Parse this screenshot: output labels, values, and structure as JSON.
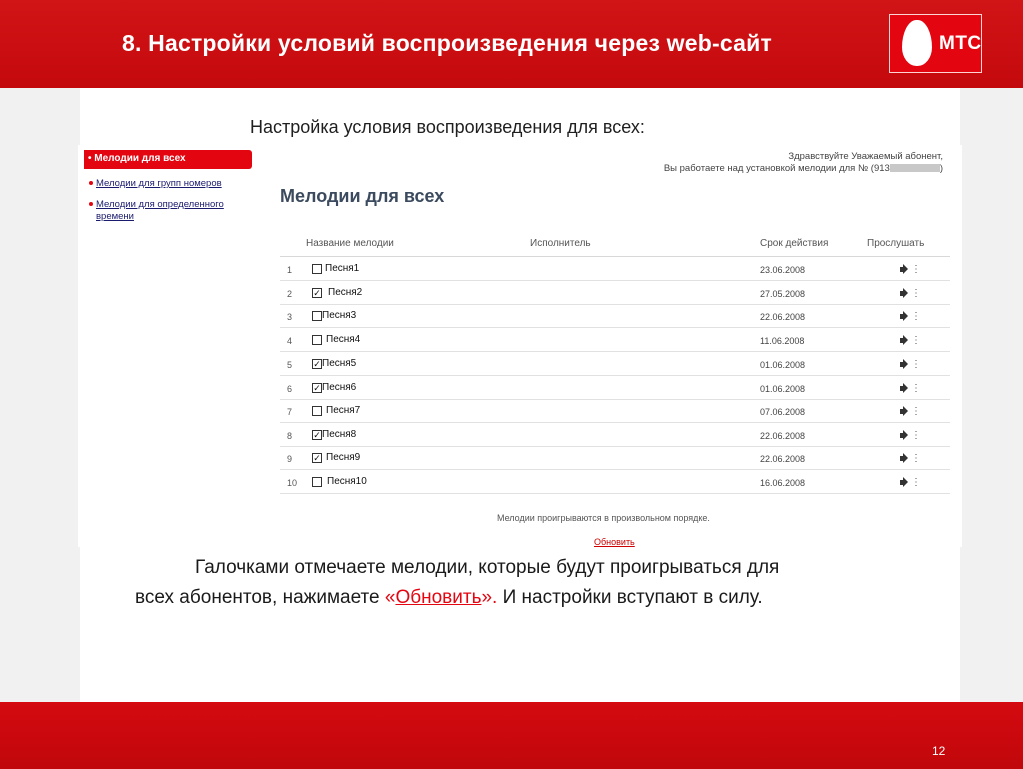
{
  "header": {
    "title": "8. Настройки условий воспроизведения через web-сайт",
    "logo_text": "МТС",
    "brand_color": "#e30611"
  },
  "subtitle": "Настройка условия воспроизведения для всех:",
  "sidebar": {
    "items": [
      {
        "label": "Мелодии для всех",
        "active": true
      },
      {
        "label": "Мелодии для групп номеров",
        "active": false
      },
      {
        "label_line1": "Мелодии для определенного",
        "label_line2": "времени",
        "active": false
      }
    ]
  },
  "greeting": {
    "line1": "Здравствуйте Уважаемый абонент,",
    "line2": "Вы работаете над установкой мелодии для № (913",
    "line2_end": ")"
  },
  "content_title": "Мелодии для всех",
  "table": {
    "headers": [
      "Название мелодии",
      "Исполнитель",
      "Срок действия",
      "Прослушать"
    ],
    "rows": [
      {
        "num": "1",
        "checked": false,
        "song": "Песня1",
        "date": "23.06.2008"
      },
      {
        "num": "2",
        "checked": true,
        "song": "Песня2",
        "date": "27.05.2008"
      },
      {
        "num": "3",
        "checked": false,
        "song": "Песня3",
        "date": "22.06.2008"
      },
      {
        "num": "4",
        "checked": false,
        "song": "Песня4",
        "date": "11.06.2008"
      },
      {
        "num": "5",
        "checked": true,
        "song": "Песня5",
        "date": "01.06.2008"
      },
      {
        "num": "6",
        "checked": true,
        "song": "Песня6",
        "date": "01.06.2008"
      },
      {
        "num": "7",
        "checked": false,
        "song": "Песня7",
        "date": "07.06.2008"
      },
      {
        "num": "8",
        "checked": true,
        "song": "Песня8",
        "date": "22.06.2008"
      },
      {
        "num": "9",
        "checked": true,
        "song": "Песня9",
        "date": "22.06.2008"
      },
      {
        "num": "10",
        "checked": false,
        "song": "Песня10",
        "date": "16.06.2008"
      }
    ],
    "play_icon": "speaker-icon"
  },
  "note": "Мелодии проигрываются в произвольном порядке.",
  "update_link": "Обновить",
  "caption": {
    "line1": "Галочками отмечаете мелодии, которые будут проигрываться для",
    "line2_start": "всех абонентов, нажимаете ",
    "quote_open": "«",
    "link": "Обновить",
    "quote_close": "». ",
    "line2_end": "И настройки вступают в силу."
  },
  "page_number": "12"
}
